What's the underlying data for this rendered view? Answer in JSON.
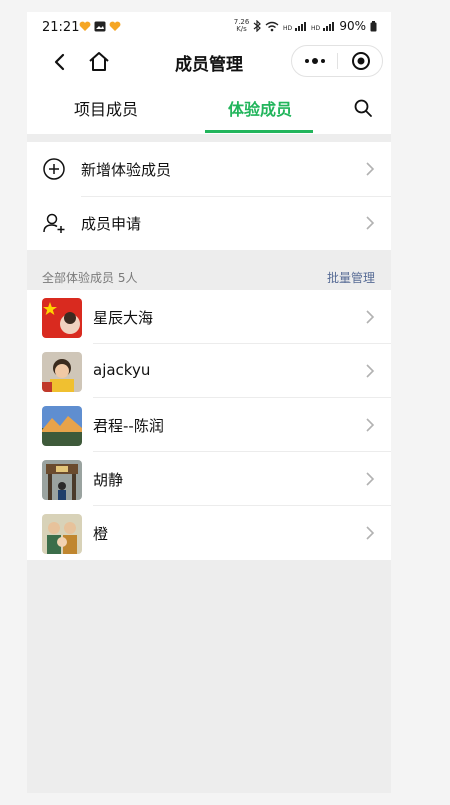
{
  "status_bar": {
    "time": "21:21",
    "speed_value": "7.26",
    "speed_unit": "K/s",
    "battery": "90%"
  },
  "nav": {
    "title": "成员管理"
  },
  "tabs": [
    {
      "label": "项目成员",
      "active": false
    },
    {
      "label": "体验成员",
      "active": true
    }
  ],
  "actions": [
    {
      "label": "新增体验成员",
      "icon": "plus-circle-icon"
    },
    {
      "label": "成员申请",
      "icon": "user-add-icon"
    }
  ],
  "section": {
    "title": "全部体验成员 5人",
    "action": "批量管理"
  },
  "members": [
    {
      "name": "星辰大海",
      "avatar": "flag-avatar"
    },
    {
      "name": "ajackyu",
      "avatar": "photo-avatar"
    },
    {
      "name": "君程--陈润",
      "avatar": "landscape-avatar"
    },
    {
      "name": "胡静",
      "avatar": "gate-avatar"
    },
    {
      "name": "橙",
      "avatar": "family-avatar"
    }
  ],
  "colors": {
    "accent": "#22b55c",
    "link": "#576b95",
    "background": "#ededed"
  }
}
